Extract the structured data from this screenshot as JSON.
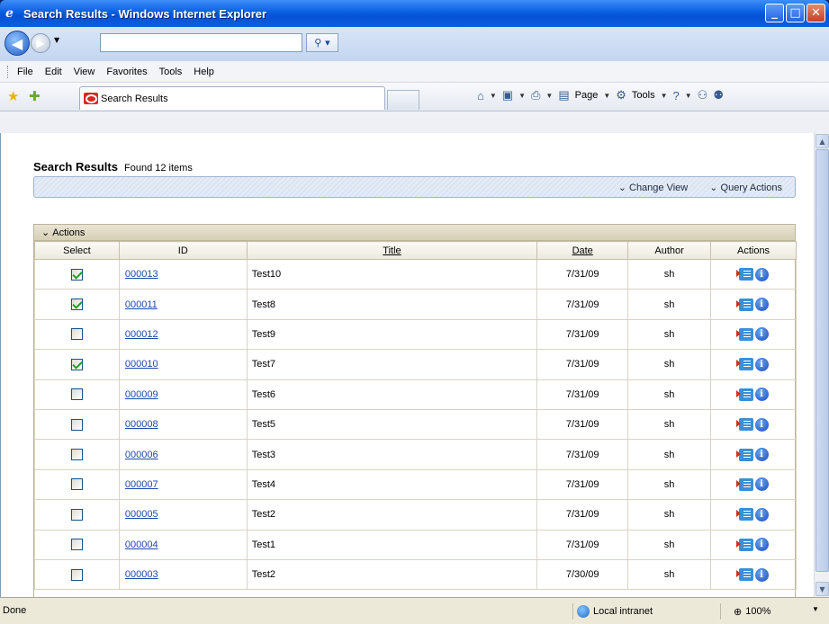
{
  "window": {
    "title": "Search Results - Windows Internet Explorer"
  },
  "address": {
    "value": ""
  },
  "menu": [
    "File",
    "Edit",
    "View",
    "Favorites",
    "Tools",
    "Help"
  ],
  "tab": {
    "label": "Search Results"
  },
  "command_bar": {
    "page_label": "Page",
    "tools_label": "Tools"
  },
  "page": {
    "heading": "Search Results",
    "count": "Found 12 items",
    "query_bar": {
      "change_view": "Change View",
      "query_actions": "Query Actions"
    },
    "panel": {
      "actions_label": "Actions",
      "columns": [
        "Select",
        "ID",
        "Title",
        "Date",
        "Author",
        "Actions"
      ],
      "rows": [
        {
          "checked": true,
          "id": "000013",
          "title": "Test10",
          "date": "7/31/09",
          "author": "sh"
        },
        {
          "checked": true,
          "id": "000011",
          "title": "Test8",
          "date": "7/31/09",
          "author": "sh"
        },
        {
          "checked": false,
          "id": "000012",
          "title": "Test9",
          "date": "7/31/09",
          "author": "sh"
        },
        {
          "checked": true,
          "id": "000010",
          "title": "Test7",
          "date": "7/31/09",
          "author": "sh"
        },
        {
          "checked": false,
          "id": "000009",
          "title": "Test6",
          "date": "7/31/09",
          "author": "sh"
        },
        {
          "checked": false,
          "id": "000008",
          "title": "Test5",
          "date": "7/31/09",
          "author": "sh"
        },
        {
          "checked": false,
          "id": "000006",
          "title": "Test3",
          "date": "7/31/09",
          "author": "sh"
        },
        {
          "checked": false,
          "id": "000007",
          "title": "Test4",
          "date": "7/31/09",
          "author": "sh"
        },
        {
          "checked": false,
          "id": "000005",
          "title": "Test2",
          "date": "7/31/09",
          "author": "sh"
        },
        {
          "checked": false,
          "id": "000004",
          "title": "Test1",
          "date": "7/31/09",
          "author": "sh"
        },
        {
          "checked": false,
          "id": "000003",
          "title": "Test2",
          "date": "7/30/09",
          "author": "sh"
        }
      ]
    }
  },
  "status": {
    "text": "Done",
    "zone": "Local intranet",
    "zoom": "100%"
  },
  "colors": {
    "titlebar": "#0a5fe0",
    "link": "#2048a8",
    "panel_header": "#d8d0b6"
  }
}
